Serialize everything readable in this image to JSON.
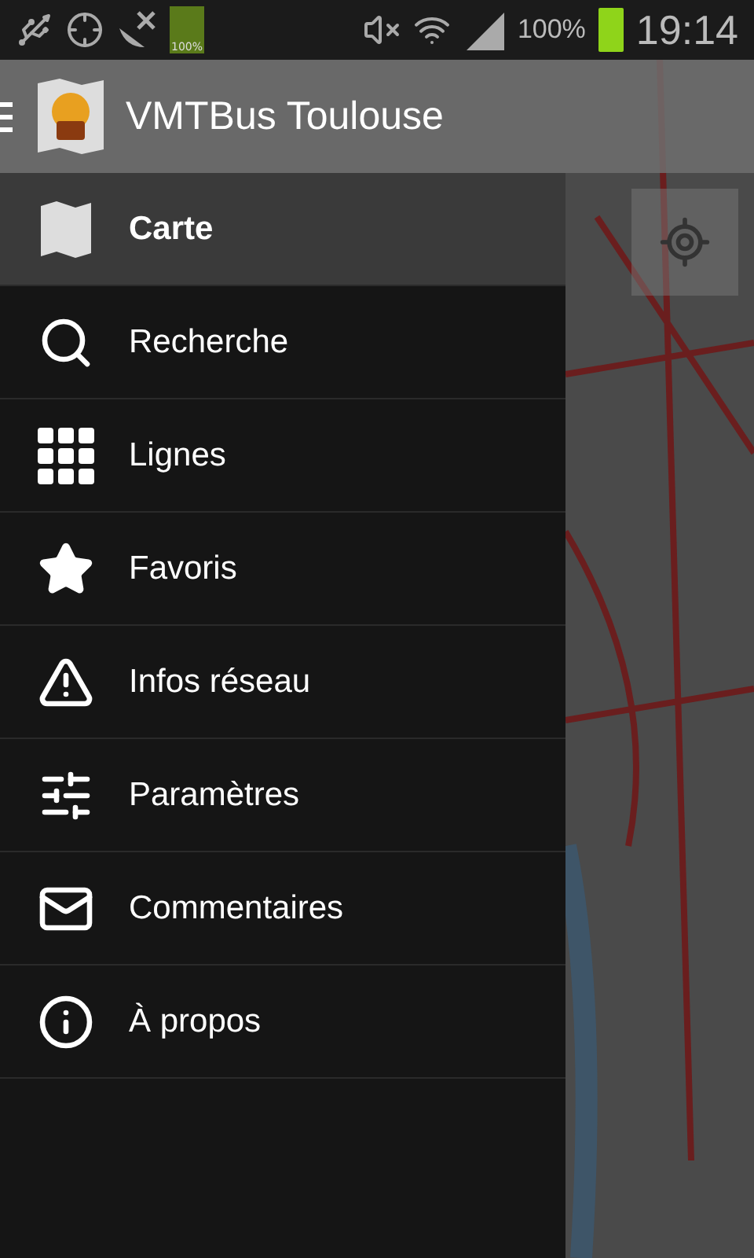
{
  "status_bar": {
    "battery_icon_label": "100%",
    "battery_percent": "100%",
    "time": "19:14"
  },
  "action_bar": {
    "title": "VMTBus Toulouse"
  },
  "drawer": {
    "items": [
      {
        "kind": "map",
        "label": "Carte",
        "selected": true
      },
      {
        "kind": "search",
        "label": "Recherche",
        "selected": false
      },
      {
        "kind": "grid",
        "label": "Lignes",
        "selected": false
      },
      {
        "kind": "star",
        "label": "Favoris",
        "selected": false
      },
      {
        "kind": "alert",
        "label": "Infos réseau",
        "selected": false
      },
      {
        "kind": "sliders",
        "label": "Paramètres",
        "selected": false
      },
      {
        "kind": "mail",
        "label": "Commentaires",
        "selected": false
      },
      {
        "kind": "info",
        "label": "À propos",
        "selected": false
      }
    ]
  }
}
